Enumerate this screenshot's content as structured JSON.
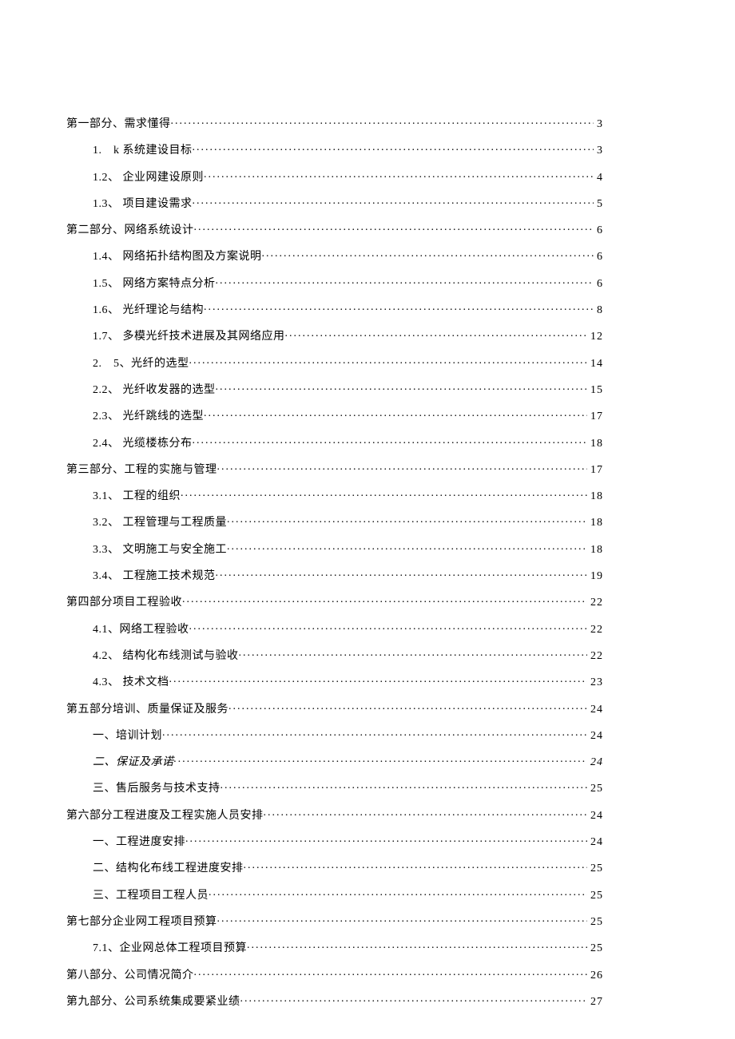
{
  "toc": [
    {
      "level": 0,
      "label": "第一部分、需求懂得",
      "page": "3",
      "italic": false
    },
    {
      "level": 1,
      "label": "1.　k 系统建设目标",
      "page": "3",
      "italic": false
    },
    {
      "level": 1,
      "label": "1.2、 企业网建设原则",
      "page": "4",
      "italic": false
    },
    {
      "level": 1,
      "label": "1.3、 项目建设需求",
      "page": "5",
      "italic": false
    },
    {
      "level": 0,
      "label": "第二部分、网络系统设计",
      "page": "6",
      "italic": false
    },
    {
      "level": 1,
      "label": "1.4、 网络拓扑结构图及方案说明",
      "page": "6",
      "italic": false
    },
    {
      "level": 1,
      "label": "1.5、 网络方案特点分析",
      "page": "6",
      "italic": false
    },
    {
      "level": 1,
      "label": "1.6、 光纤理论与结构",
      "page": "8",
      "italic": false
    },
    {
      "level": 1,
      "label": "1.7、 多模光纤技术进展及其网络应用",
      "page": "12",
      "italic": false
    },
    {
      "level": 1,
      "label": "2.　5、光纤的选型",
      "page": "14",
      "italic": false
    },
    {
      "level": 1,
      "label": "2.2、 光纤收发器的选型",
      "page": "15",
      "italic": false
    },
    {
      "level": 1,
      "label": "2.3、 光纤跳线的选型",
      "page": "17",
      "italic": false
    },
    {
      "level": 1,
      "label": "2.4、 光缆楼栋分布",
      "page": "18",
      "italic": false
    },
    {
      "level": 0,
      "label": "第三部分、工程的实施与管理",
      "page": "17",
      "italic": false
    },
    {
      "level": 1,
      "label": "3.1、 工程的组织",
      "page": "18",
      "italic": false
    },
    {
      "level": 1,
      "label": "3.2、 工程管理与工程质量",
      "page": "18",
      "italic": false
    },
    {
      "level": 1,
      "label": "3.3、 文明施工与安全施工",
      "page": "18",
      "italic": false
    },
    {
      "level": 1,
      "label": "3.4、 工程施工技术规范",
      "page": "19",
      "italic": false
    },
    {
      "level": 0,
      "label": "第四部分项目工程验收",
      "page": "22",
      "italic": false
    },
    {
      "level": 1,
      "label": "4.1、网络工程验收",
      "page": "22",
      "italic": false
    },
    {
      "level": 1,
      "label": "4.2、 结构化布线测试与验收",
      "page": "22",
      "italic": false
    },
    {
      "level": 1,
      "label": "4.3、 技术文档",
      "page": "23",
      "italic": false
    },
    {
      "level": 0,
      "label": "第五部分培训、质量保证及服务",
      "page": "24",
      "italic": false
    },
    {
      "level": 1,
      "label": "一、培训计划",
      "page": "24",
      "italic": false
    },
    {
      "level": 1,
      "label": "二、保证及承诺",
      "page": "24",
      "italic": true
    },
    {
      "level": 1,
      "label": "三、售后服务与技术支持",
      "page": "25",
      "italic": false
    },
    {
      "level": 0,
      "label": "第六部分工程进度及工程实施人员安排",
      "page": "24",
      "italic": false
    },
    {
      "level": 1,
      "label": "一、工程进度安排",
      "page": "24",
      "italic": false
    },
    {
      "level": 1,
      "label": "二、结构化布线工程进度安排",
      "page": "25",
      "italic": false
    },
    {
      "level": 1,
      "label": "三、工程项目工程人员",
      "page": "25",
      "italic": false
    },
    {
      "level": 0,
      "label": "第七部分企业网工程项目预算",
      "page": "25",
      "italic": false
    },
    {
      "level": 1,
      "label": "7.1、企业网总体工程项目预算",
      "page": "25",
      "italic": false
    },
    {
      "level": 0,
      "label": "第八部分、公司情况简介",
      "page": "26",
      "italic": false
    },
    {
      "level": 0,
      "label": "第九部分、公司系统集成要紧业绩",
      "page": "27",
      "italic": false
    }
  ]
}
